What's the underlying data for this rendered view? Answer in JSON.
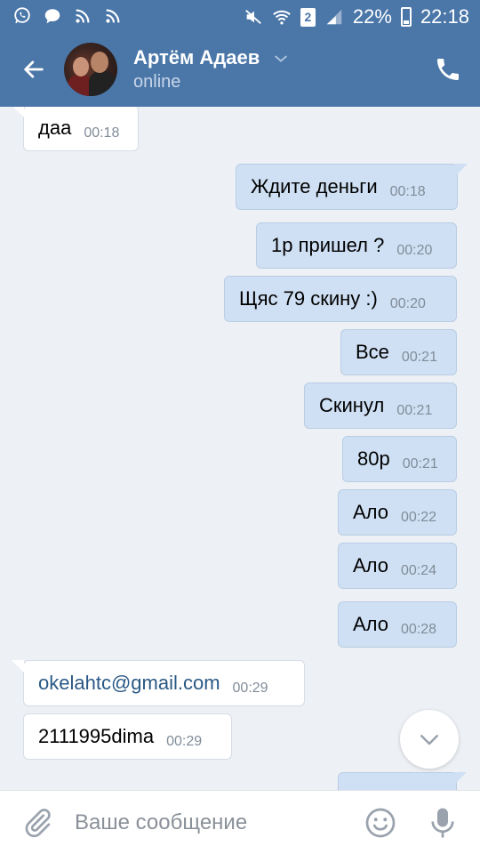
{
  "status_bar": {
    "battery": "22%",
    "time": "22:18",
    "sim_label": "2"
  },
  "header": {
    "contact_name": "Артём Адаев",
    "contact_status": "online"
  },
  "messages": [
    {
      "direction": "in",
      "text": "даа",
      "time": "00:18"
    },
    {
      "direction": "out",
      "text": "Ждите деньги",
      "time": "00:18"
    },
    {
      "direction": "out",
      "text": "1р пришел ?",
      "time": "00:20"
    },
    {
      "direction": "out",
      "text": "Щяс 79 скину :)",
      "time": "00:20"
    },
    {
      "direction": "out",
      "text": "Все",
      "time": "00:21"
    },
    {
      "direction": "out",
      "text": "Скинул",
      "time": "00:21"
    },
    {
      "direction": "out",
      "text": "80р",
      "time": "00:21"
    },
    {
      "direction": "out",
      "text": "Ало",
      "time": "00:22"
    },
    {
      "direction": "out",
      "text": "Ало",
      "time": "00:24"
    },
    {
      "direction": "out",
      "text": "Ало",
      "time": "00:28"
    },
    {
      "direction": "in",
      "text": "okelahtc@gmail.com",
      "time": "00:29"
    },
    {
      "direction": "in",
      "text": "2111995dima",
      "time": "00:29"
    }
  ],
  "composer": {
    "placeholder": "Ваше сообщение"
  },
  "colors": {
    "header_bg": "#4a76a8",
    "chat_bg": "#edf0f5",
    "outgoing_bubble": "#cfe0f4",
    "incoming_bubble": "#ffffff",
    "link": "#2a5885"
  },
  "icons": {
    "status_left": [
      "whatsapp-icon",
      "chat-icon",
      "rss-icon",
      "rss-icon"
    ],
    "status_right": [
      "mute-icon",
      "wifi-icon",
      "sim-icon",
      "signal-icon",
      "battery-icon"
    ],
    "header": [
      "back-arrow-icon",
      "chevron-down-icon",
      "phone-icon"
    ],
    "composer": [
      "paperclip-icon",
      "emoji-icon",
      "microphone-icon"
    ],
    "scroll": "chevron-down-icon"
  }
}
